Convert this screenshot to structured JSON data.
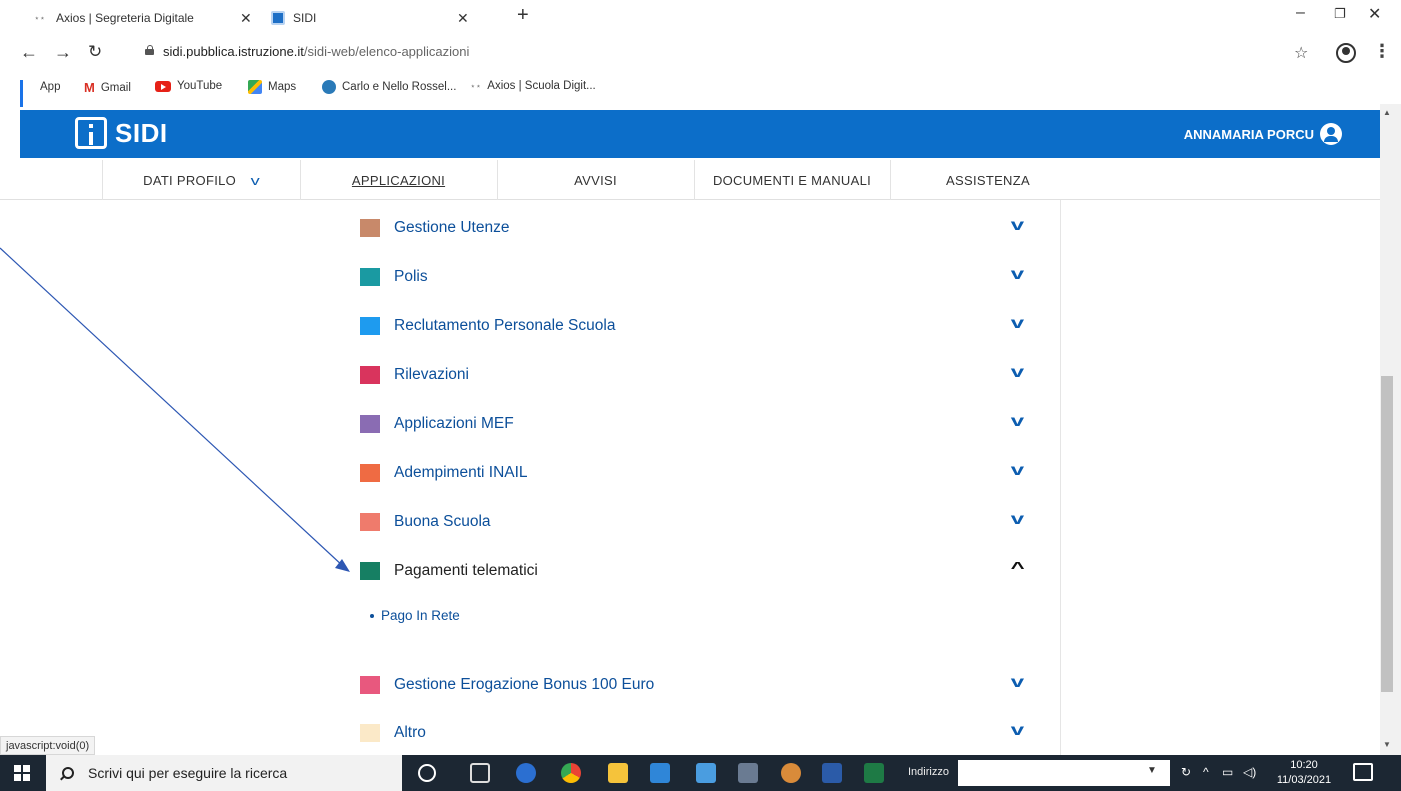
{
  "browser": {
    "tabs": [
      {
        "title": "Axios | Segreteria Digitale",
        "active": false
      },
      {
        "title": "SIDI",
        "active": true
      }
    ],
    "new_tab": "+",
    "url_host": "sidi.pubblica.istruzione.it",
    "url_path": "/sidi-web/elenco-applicazioni",
    "bookmarks": [
      {
        "label": "App",
        "icon": "apps-grid-icon"
      },
      {
        "label": "Gmail",
        "icon": "gmail-icon"
      },
      {
        "label": "YouTube",
        "icon": "youtube-icon"
      },
      {
        "label": "Maps",
        "icon": "maps-icon"
      },
      {
        "label": "Carlo e Nello Rossel...",
        "icon": "school-icon"
      },
      {
        "label": "Axios | Scuola Digit...",
        "icon": "axios-icon"
      }
    ],
    "status_text": "javascript:void(0)"
  },
  "sidi": {
    "logo_text": "SIDI",
    "user_name": "ANNAMARIA PORCU",
    "nav": [
      {
        "label": "DATI PROFILO",
        "has_dropdown": true
      },
      {
        "label": "APPLICAZIONI",
        "active": true
      },
      {
        "label": "AVVISI"
      },
      {
        "label": "DOCUMENTI E MANUALI"
      },
      {
        "label": "ASSISTENZA"
      }
    ],
    "apps": [
      {
        "label": "Gestione Utenze",
        "color": "#c8896a",
        "expanded": false
      },
      {
        "label": "Polis",
        "color": "#1a9aa2",
        "expanded": false
      },
      {
        "label": "Reclutamento Personale Scuola",
        "color": "#1e9bef",
        "expanded": false
      },
      {
        "label": "Rilevazioni",
        "color": "#d9345d",
        "expanded": false
      },
      {
        "label": "Applicazioni MEF",
        "color": "#8a6cb3",
        "expanded": false
      },
      {
        "label": "Adempimenti INAIL",
        "color": "#ef6b43",
        "expanded": false
      },
      {
        "label": "Buona Scuola",
        "color": "#ef7b6c",
        "expanded": false
      },
      {
        "label": "Pagamenti telematici",
        "color": "#167f63",
        "expanded": true
      },
      {
        "label": "Gestione Erogazione Bonus 100 Euro",
        "color": "#e8587e",
        "expanded": false
      },
      {
        "label": "Altro",
        "color": "#fbe9c8",
        "expanded": false
      }
    ],
    "subitems": [
      "Pago In Rete"
    ]
  },
  "taskbar": {
    "search_placeholder": "Scrivi qui per eseguire la ricerca",
    "address_label": "Indirizzo",
    "time": "10:20",
    "date": "11/03/2021"
  }
}
